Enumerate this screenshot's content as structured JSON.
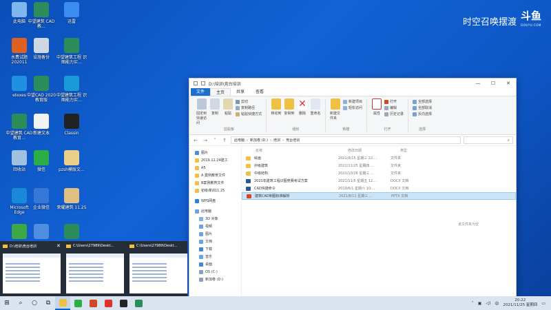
{
  "watermark": {
    "text": "时空召唤摆渡",
    "logo": "斗鱼",
    "logo_sub": "DOUYU.COM"
  },
  "desktop_icons": [
    {
      "label": "此电脑",
      "color": "#7fb6ee"
    },
    {
      "label": "中望建筑 CAD教…",
      "color": "#2c8c5a"
    },
    {
      "label": "迅雷",
      "color": "#3b8ef0"
    },
    {
      "label": "水费试题 202011",
      "color": "#e06020"
    },
    {
      "label": "设施备份",
      "color": "#cfd7e3"
    },
    {
      "label": "中望建筑工程 识图能力实…",
      "color": "#2c8c5a"
    },
    {
      "label": "etexes",
      "color": "#2090e0"
    },
    {
      "label": "中望CAD 2020 教育版",
      "color": "#2c8c5a"
    },
    {
      "label": "中望建筑工程 识图能力实…",
      "color": "#1a9bd8"
    },
    {
      "label": "中望建筑 CAD 教育…",
      "color": "#2c8c5a"
    },
    {
      "label": "新建文本",
      "color": "#f2f2f2"
    },
    {
      "label": "Classin",
      "color": "#222222"
    },
    {
      "label": "回收站",
      "color": "#9fc0e0"
    },
    {
      "label": "微信",
      "color": "#2bae45"
    },
    {
      "label": "pzsh模版文…",
      "color": "#e8d088"
    },
    {
      "label": "Microsoft Edge",
      "color": "#1a8ad8"
    },
    {
      "label": "企业微信",
      "color": "#3678d8"
    },
    {
      "label": "荣耀建筑 11.25",
      "color": "#e0c080"
    },
    {
      "label": "",
      "color": "#3da844"
    },
    {
      "label": "",
      "color": "#4f8ee0"
    },
    {
      "label": "",
      "color": "#2c8c5a"
    }
  ],
  "explorer": {
    "title": "D:\\培训\\竞台培训",
    "tabs": [
      "文件",
      "主页",
      "共享",
      "查看"
    ],
    "ribbon": {
      "clipboard": {
        "name": "剪贴板",
        "pin": "固定到快速访问",
        "copy": "复制",
        "paste": "粘贴",
        "cut": "剪切",
        "copy_path": "复制路径",
        "paste_shortcut": "粘贴快捷方式"
      },
      "organize": {
        "name": "组织",
        "move_to": "移动到",
        "copy_to": "复制到",
        "delete": "删除",
        "rename": "重命名"
      },
      "new": {
        "name": "新建",
        "new_folder": "新建文件夹",
        "new_item": "新建项目",
        "easy_access": "轻松访问"
      },
      "open": {
        "name": "打开",
        "properties": "属性",
        "open": "打开",
        "edit": "编辑",
        "history": "历史记录"
      },
      "select": {
        "name": "选择",
        "select_all": "全部选择",
        "select_none": "全部取消",
        "invert": "反向选择"
      }
    },
    "address": [
      "此电脑",
      "新加卷 (D:)",
      "培训",
      "竞台培训"
    ],
    "columns": [
      "名称",
      "修改日期",
      "类型"
    ],
    "files": [
      {
        "name": "绘画",
        "date": "2021/9/15 星期三 22:…",
        "type": "文件夹",
        "icon": "#f0c040"
      },
      {
        "name": "中级建筑",
        "date": "2021/11/25 星期四 …",
        "type": "文件夹",
        "icon": "#f0c040"
      },
      {
        "name": "中级结构",
        "date": "2021/10/26 星期三 …",
        "type": "文件夹",
        "icon": "#f0c040"
      },
      {
        "name": "2021年建筑工程识图竞赛考试方案",
        "date": "2021/11/5 星期五 12…",
        "type": "DOCX 文档",
        "icon": "#2b5797"
      },
      {
        "name": "CAD快捷命令",
        "date": "2019/6/1 星期六 10:…",
        "type": "DOCX 文档",
        "icon": "#2b5797"
      },
      {
        "name": "建筑CAD制图标准解析",
        "date": "2021/8/11 星期三 …",
        "type": "PPTX 文档",
        "icon": "#d24726"
      }
    ],
    "nav": [
      {
        "label": "图片",
        "color": "#4a90d9"
      },
      {
        "label": "2019.11.24建工",
        "color": "#f0c040"
      },
      {
        "label": "A5",
        "color": "#f0c040"
      },
      {
        "label": "A 案例教育文件",
        "color": "#f0c040"
      },
      {
        "label": "B案例教育文件",
        "color": "#f0c040"
      },
      {
        "label": "初级课训11.25",
        "color": "#f0c040"
      },
      {
        "label": "WPS网盘",
        "color": "#2a7de1"
      },
      {
        "label": "此电脑",
        "color": "#6aa3df"
      },
      {
        "label": "3D 对象",
        "color": "#7fb2e6"
      },
      {
        "label": "视频",
        "color": "#6aa3df"
      },
      {
        "label": "图片",
        "color": "#6aa3df"
      },
      {
        "label": "文档",
        "color": "#6aa3df"
      },
      {
        "label": "下载",
        "color": "#3d86d8"
      },
      {
        "label": "音乐",
        "color": "#6aa3df"
      },
      {
        "label": "桌面",
        "color": "#3d86d8"
      },
      {
        "label": "OS (C:)",
        "color": "#8aa0b8"
      },
      {
        "label": "新加卷 (D:)",
        "color": "#8aa0b8"
      }
    ],
    "empty_text": "该文件夹为空"
  },
  "previews": [
    {
      "title": "D:\\培训\\竞台培训"
    },
    {
      "title": "C:\\Users\\27989\\Deskt…"
    },
    {
      "title": "C:\\Users\\27989\\Deskt…"
    }
  ],
  "taskbar": {
    "apps": [
      {
        "name": "file-explorer",
        "color": "#f0c040",
        "active": true
      },
      {
        "name": "wechat",
        "color": "#2bae45",
        "active": false
      },
      {
        "name": "powerpoint",
        "color": "#d24726",
        "active": false
      },
      {
        "name": "wps",
        "color": "#e03030",
        "active": false
      },
      {
        "name": "classin",
        "color": "#222222",
        "active": false
      },
      {
        "name": "zwcad",
        "color": "#2c8c5a",
        "active": false
      }
    ],
    "time": "20:22",
    "date": "2021/11/25 星期四",
    "tray_text": "中"
  }
}
